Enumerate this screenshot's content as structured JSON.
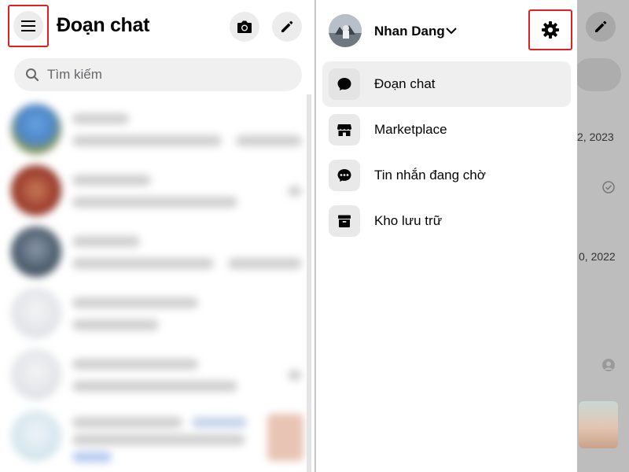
{
  "left": {
    "title": "Đoạn chat",
    "search_placeholder": "Tìm kiếm"
  },
  "drawer": {
    "profile_name": "Nhan Dang",
    "items": [
      {
        "label": "Đoạn chat",
        "icon": "chat-bubble-icon",
        "active": true
      },
      {
        "label": "Marketplace",
        "icon": "store-icon",
        "active": false
      },
      {
        "label": "Tin nhắn đang chờ",
        "icon": "chat-dots-icon",
        "active": false
      },
      {
        "label": "Kho lưu trữ",
        "icon": "archive-box-icon",
        "active": false
      }
    ]
  },
  "background_peek": {
    "date_1": "2, 2023",
    "date_2": "0, 2022"
  },
  "colors": {
    "highlight_border": "#e02020",
    "active_item_bg": "#efefef",
    "overlay": "#bdbdbd"
  }
}
